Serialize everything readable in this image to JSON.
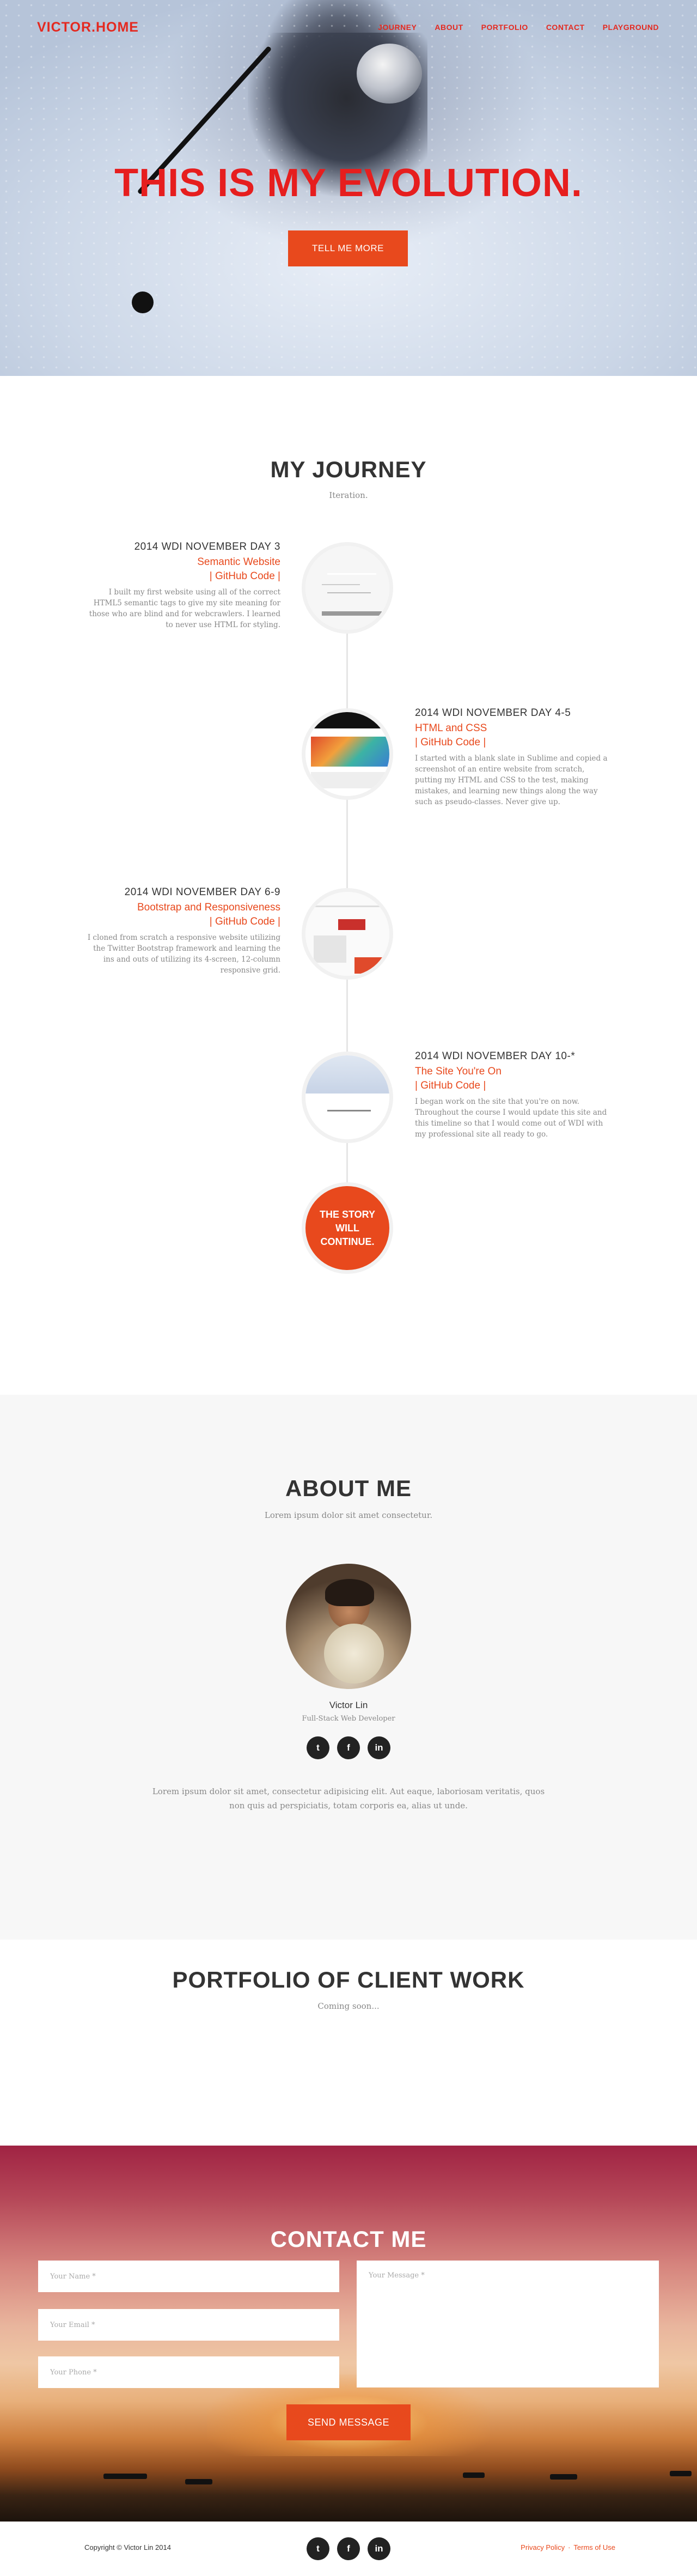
{
  "colors": {
    "accent": "#e8491d",
    "brand_red": "#e42920",
    "dark": "#222222",
    "about_bg": "#f7f7f7"
  },
  "nav": {
    "logo": "VICTOR.HOME",
    "links": [
      "JOURNEY",
      "ABOUT",
      "PORTFOLIO",
      "CONTACT",
      "PLAYGROUND"
    ]
  },
  "hero": {
    "title": "THIS IS MY EVOLUTION.",
    "button": "TELL ME MORE"
  },
  "journey": {
    "title": "MY JOURNEY",
    "subtitle": "Iteration.",
    "items": [
      {
        "date": "2014 WDI NOVEMBER DAY 3",
        "name": "Semantic Website",
        "link": "| GitHub Code |",
        "desc": "I built my first website using all of the correct HTML5 semantic tags to give my site meaning for those who are blind and for webcrawlers. I learned to never use HTML for styling."
      },
      {
        "date": "2014 WDI NOVEMBER DAY 4-5",
        "name": "HTML and CSS",
        "link": "| GitHub Code |",
        "desc": "I started with a blank slate in Sublime and copied a screenshot of an entire website from scratch, putting my HTML and CSS to the test, making mistakes, and learning new things along the way such as pseudo-classes. Never give up."
      },
      {
        "date": "2014 WDI NOVEMBER DAY 6-9",
        "name": "Bootstrap and Responsiveness",
        "link": "| GitHub Code |",
        "desc": "I cloned from scratch a responsive website utilizing the Twitter Bootstrap framework and learning the ins and outs of utilizing its 4-screen, 12-column responsive grid."
      },
      {
        "date": "2014 WDI NOVEMBER DAY 10-*",
        "name": "The Site You're On",
        "link": "| GitHub Code |",
        "desc": "I began work on the site that you're on now. Throughout the course I would update this site and this timeline so that I would come out of WDI with my professional site all ready to go."
      }
    ],
    "end_line1": "THE STORY",
    "end_line2": "WILL",
    "end_line3": "CONTINUE."
  },
  "about": {
    "title": "ABOUT ME",
    "subtitle": "Lorem ipsum dolor sit amet consectetur.",
    "name": "Victor Lin",
    "role": "Full-Stack Web Developer",
    "text": "Lorem ipsum dolor sit amet, consectetur adipisicing elit. Aut eaque, laboriosam veritatis, quos non quis ad perspiciatis, totam corporis ea, alias ut unde.",
    "social": [
      "twitter-icon",
      "facebook-icon",
      "linkedin-icon"
    ]
  },
  "portfolio": {
    "title": "PORTFOLIO OF CLIENT WORK",
    "subtitle": "Coming soon..."
  },
  "contact": {
    "title": "CONTACT ME",
    "name_placeholder": "Your Name *",
    "email_placeholder": "Your Email *",
    "phone_placeholder": "Your Phone *",
    "message_placeholder": "Your Message *",
    "button": "SEND MESSAGE"
  },
  "footer": {
    "copyright": "Copyright © Victor Lin 2014",
    "privacy": "Privacy Policy",
    "separator": "·",
    "terms": "Terms of Use"
  }
}
